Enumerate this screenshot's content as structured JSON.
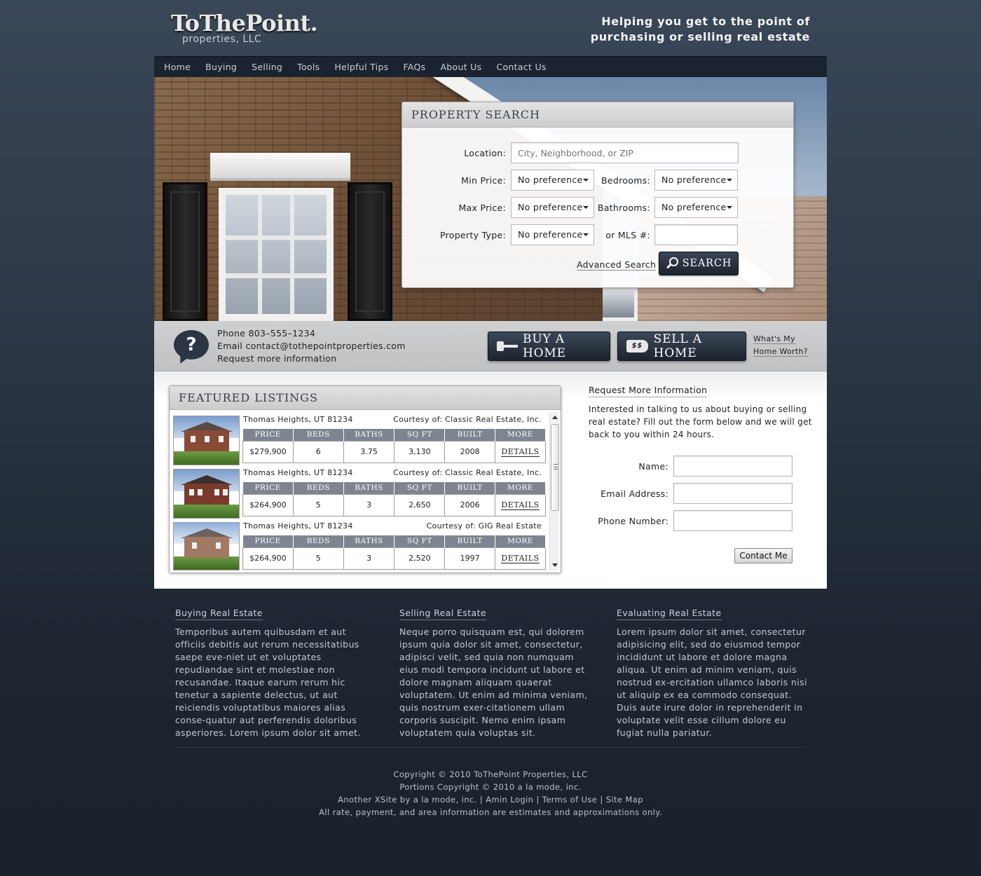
{
  "header": {
    "logo_main": "ToThePoint.",
    "logo_sub": "properties, LLC",
    "tagline_line1": "Helping you get to the point of",
    "tagline_line2": "purchasing or selling real estate"
  },
  "nav": {
    "items": [
      "Home",
      "Buying",
      "Selling",
      "Tools",
      "Helpful Tips",
      "FAQs",
      "About Us",
      "Contact Us"
    ]
  },
  "search": {
    "title": "PROPERTY SEARCH",
    "location_label": "Location:",
    "location_placeholder": "City, Neighborhood, or ZIP",
    "min_price_label": "Min Price:",
    "min_price_value": "No preference",
    "bedrooms_label": "Bedrooms:",
    "bedrooms_value": "No preference",
    "max_price_label": "Max Price:",
    "max_price_value": "No preference",
    "bathrooms_label": "Bathrooms:",
    "bathrooms_value": "No preference",
    "property_type_label": "Property Type:",
    "property_type_value": "No preference",
    "mls_label": "or MLS #:",
    "mls_value": "",
    "advanced_link": "Advanced Search",
    "search_button": "SEARCH"
  },
  "contact_strip": {
    "question_mark": "?",
    "phone": "Phone 803–555–1234",
    "email": "Email contact@tothepointproperties.com",
    "request": "Request more information",
    "buy_button": "BUY A HOME",
    "sell_button": "SELL A HOME",
    "sell_tag": "$$",
    "worth_line1": "What's My",
    "worth_line2": "Home Worth?"
  },
  "featured": {
    "title": "FEATURED LISTINGS",
    "columns": [
      "PRICE",
      "BEDS",
      "BATHS",
      "SQ FT",
      "BUILT",
      "MORE"
    ],
    "listings": [
      {
        "address": "Thomas Heights, UT 81234",
        "courtesy": "Courtesy of: Classic Real Estate, Inc.",
        "price": "$279,900",
        "beds": "6",
        "baths": "3.75",
        "sqft": "3,130",
        "built": "2008",
        "more": "DETAILS"
      },
      {
        "address": "Thomas Heights, UT 81234",
        "courtesy": "Courtesy of: Classic Real Estate, Inc.",
        "price": "$264,900",
        "beds": "5",
        "baths": "3",
        "sqft": "2,650",
        "built": "2006",
        "more": "DETAILS"
      },
      {
        "address": "Thomas Heights, UT 81234",
        "courtesy": "Courtesy of: GIG Real Estate",
        "price": "$264,900",
        "beds": "5",
        "baths": "3",
        "sqft": "2,520",
        "built": "1997",
        "more": "DETAILS"
      }
    ]
  },
  "request_form": {
    "title": "Request More Information",
    "text": "Interested in talking to us about buying or selling real estate? Fill out the form below and we will get back to you within 24 hours.",
    "name_label": "Name:",
    "email_label": "Email Address:",
    "phone_label": "Phone Number:",
    "submit": "Contact Me"
  },
  "columns": [
    {
      "title": "Buying Real Estate",
      "text": "Temporibus autem quibusdam et aut officiis debitis aut rerum necessitatibus saepe eve-niet ut et voluptates repudiandae sint et molestiae non recusandae. Itaque earum rerum hic tenetur a sapiente delectus, ut aut reiciendis voluptatibus maiores alias conse-quatur aut perferendis doloribus asperiores. Lorem ipsum dolor sit amet."
    },
    {
      "title": "Selling Real Estate",
      "text": "Neque porro quisquam est, qui dolorem ipsum quia dolor sit amet, consectetur, adipisci velit, sed quia non numquam eius modi tempora incidunt ut labore et dolore magnam aliquam quaerat voluptatem. Ut enim ad minima veniam, quis nostrum exer-citationem ullam corporis suscipit. Nemo enim ipsam voluptatem quia voluptas sit."
    },
    {
      "title": "Evaluating Real Estate",
      "text": "Lorem ipsum dolor sit amet, consectetur adipisicing elit, sed do eiusmod tempor incididunt ut labore et dolore magna aliqua. Ut enim ad minim veniam, quis nostrud ex-ercitation ullamco laboris nisi ut aliquip ex ea commodo consequat. Duis aute irure dolor in reprehenderit in voluptate velit esse cillum dolore eu fugiat nulla pariatur."
    }
  ],
  "footer": {
    "line1": "Copyright © 2010 ToThePoint Properties, LLC",
    "line2": "Portions Copyright © 2010 a la mode, inc.",
    "xsite": "Another XSite by a la mode, inc.",
    "sep": "|",
    "admin_login": "Amin Login",
    "terms": "Terms of Use",
    "sitemap": "Site Map",
    "line4": "All rate, payment, and area information are estimates and approximations only."
  },
  "colors": {
    "page_bg_top": "#3a4758",
    "page_bg_bottom": "#1a212b",
    "nav_bg": "#1b2330",
    "button_dark": "#1d2430",
    "table_header": "#7e8591"
  },
  "icons": [
    "magnifier-icon",
    "question-bubble-icon",
    "key-icon",
    "price-tag-icon"
  ]
}
